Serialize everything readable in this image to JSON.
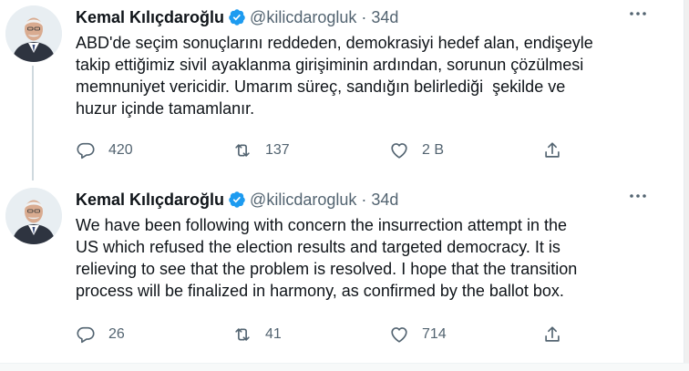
{
  "tweets": [
    {
      "author": {
        "name": "Kemal Kılıçdaroğlu",
        "handle": "@kilicdarogluk",
        "separator": "·",
        "time": "34d",
        "verified": true
      },
      "text": "ABD'de seçim sonuçlarını reddeden, demokrasiyi hedef alan, endişeyle\ntakip ettiğimiz sivil ayaklanma girişiminin ardından, sorunun çözülmesi\nmemnuniyet vericidir. Umarım süreç, sandığın belirlediği  şekilde ve\nhuzur içinde tamamlanır.",
      "actions": {
        "reply_count": "420",
        "retweet_count": "137",
        "like_count": "2 B"
      }
    },
    {
      "author": {
        "name": "Kemal Kılıçdaroğlu",
        "handle": "@kilicdarogluk",
        "separator": "·",
        "time": "34d",
        "verified": true
      },
      "text": "We have been following with concern the insurrection attempt in the\nUS which refused the election results and targeted democracy. It is\nrelieving to see that the problem is resolved. I hope that the transition\nprocess will be finalized in harmony, as confirmed by the ballot box.",
      "actions": {
        "reply_count": "26",
        "retweet_count": "41",
        "like_count": "714"
      }
    }
  ],
  "icons": {
    "verified": "verified-badge-icon",
    "more": "more-options-icon",
    "reply": "reply-icon",
    "retweet": "retweet-icon",
    "like": "like-icon",
    "share": "share-icon"
  },
  "colors": {
    "text": "#0f1419",
    "secondary": "#536471",
    "verified": "#1d9bf0",
    "thread_line": "#cfd9de"
  }
}
